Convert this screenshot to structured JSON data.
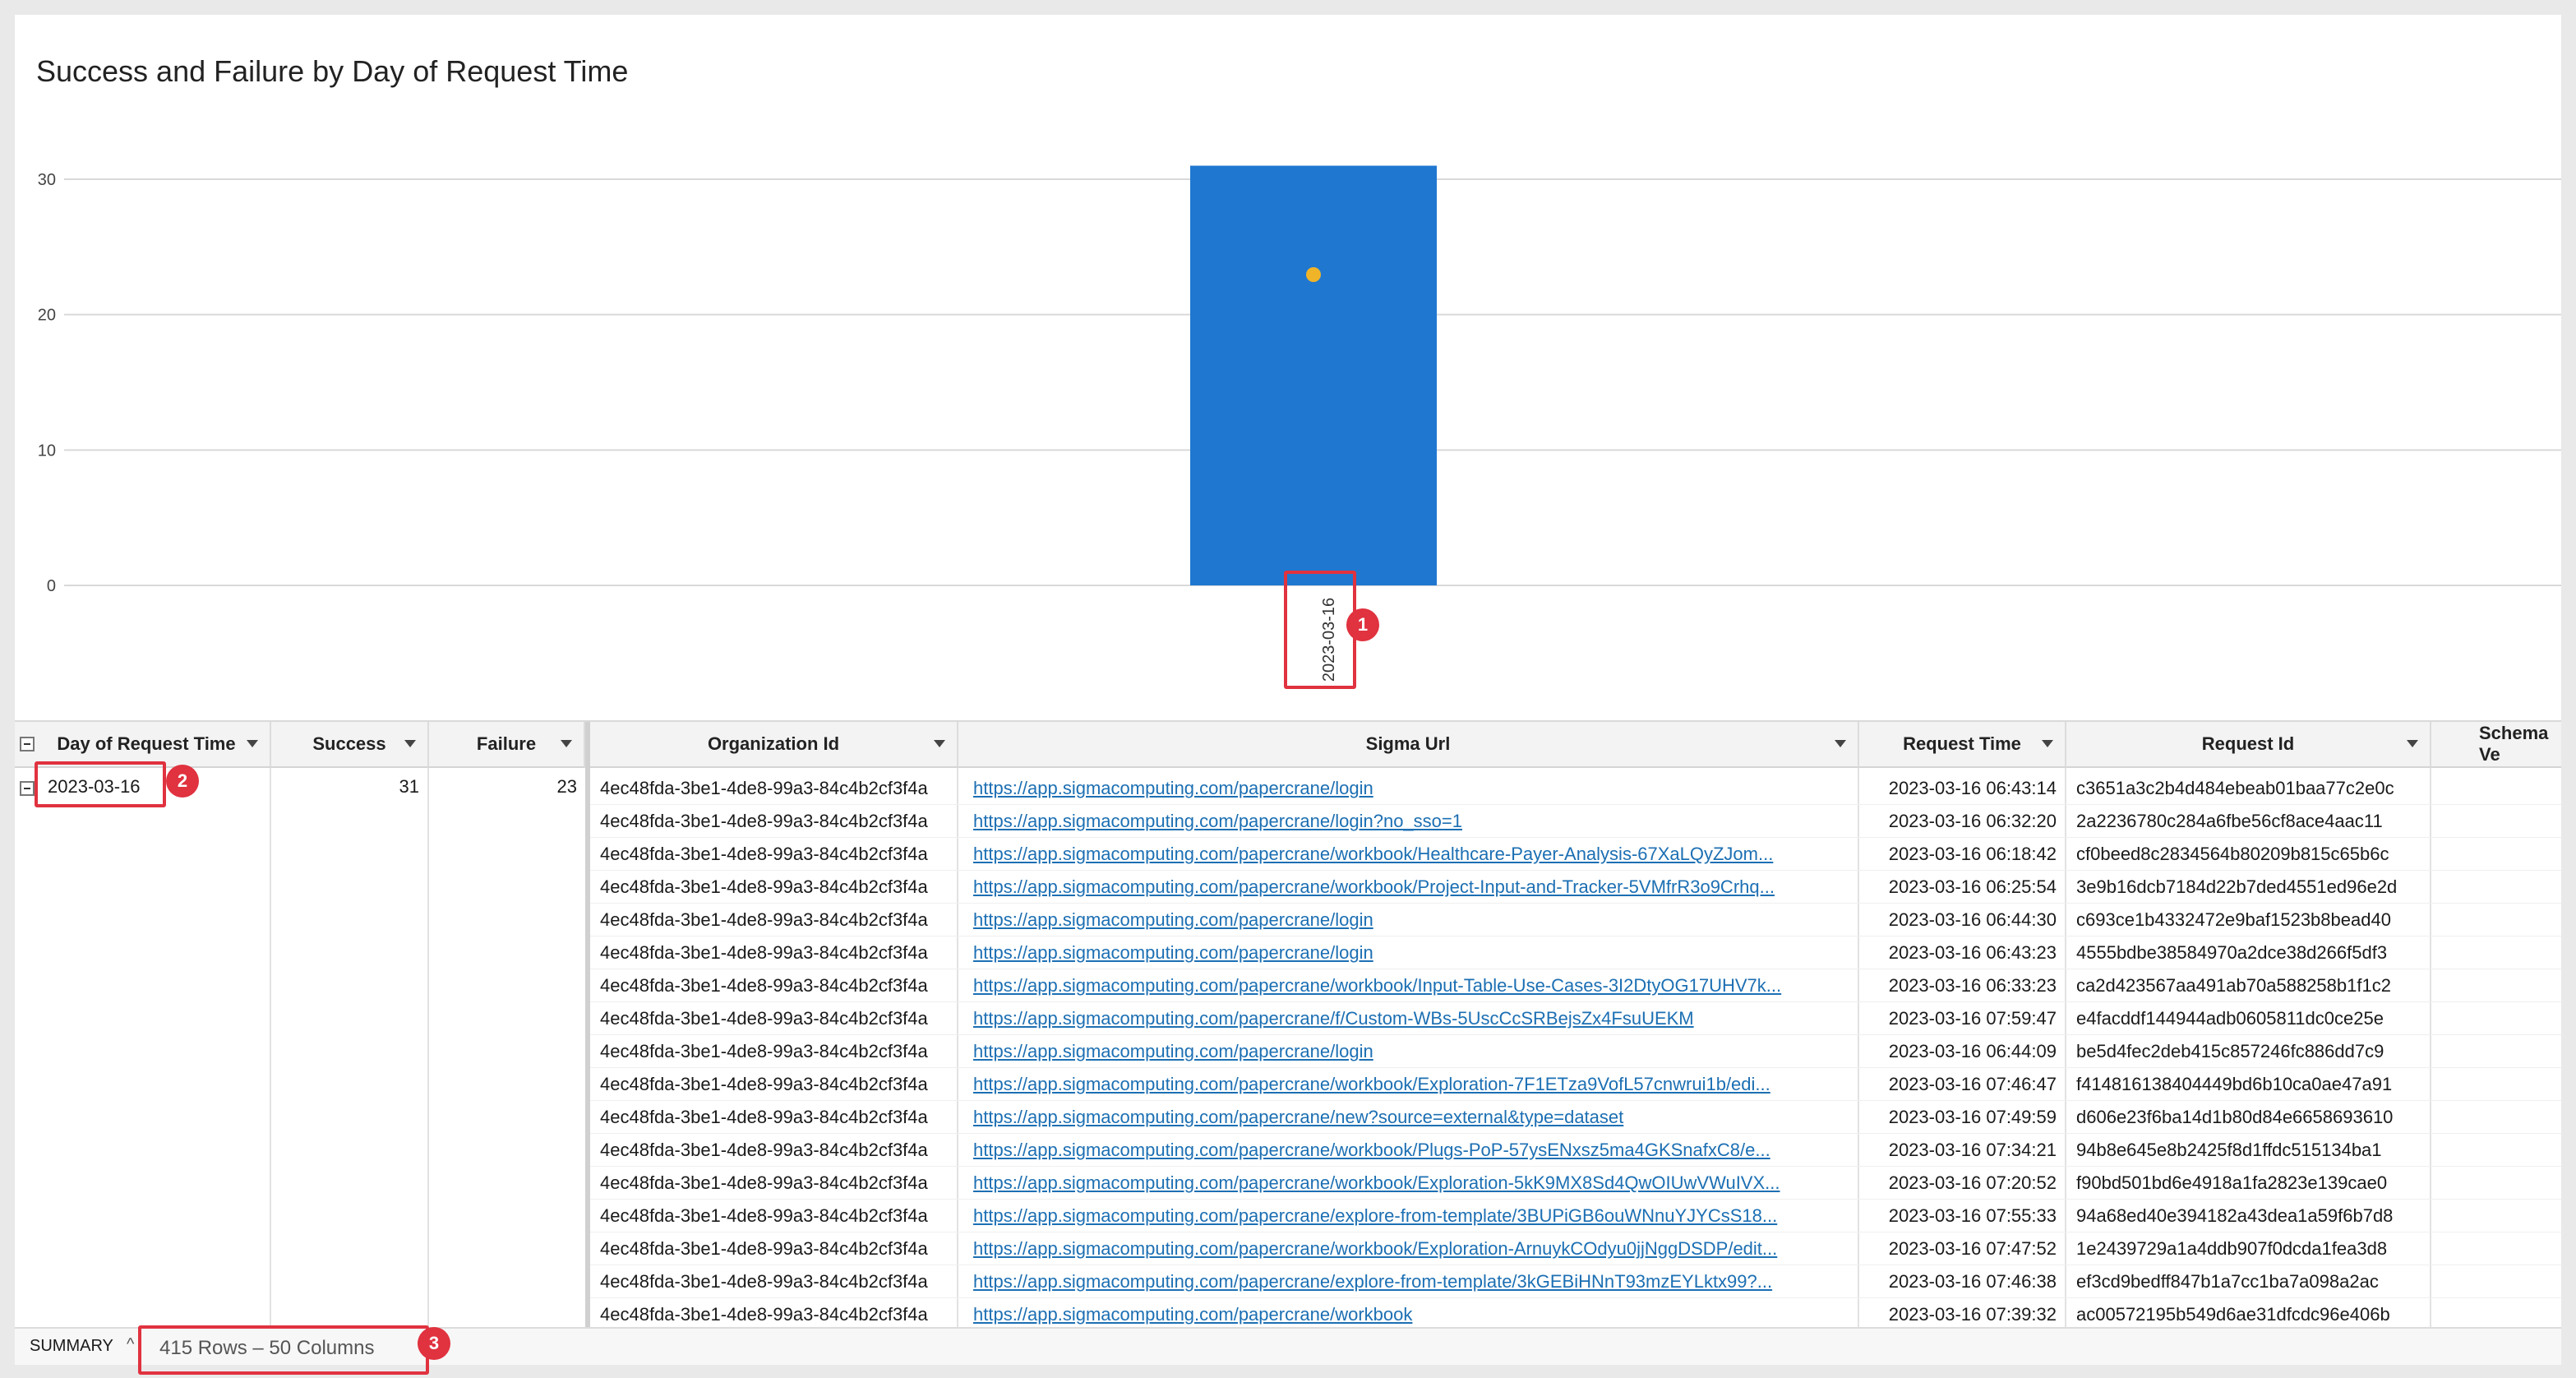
{
  "chart": {
    "title": "Success and Failure by Day of Request Time"
  },
  "chart_data": {
    "type": "bar",
    "title": "Success and Failure by Day of Request Time",
    "categories": [
      "2023-03-16"
    ],
    "series": [
      {
        "name": "Success",
        "values": [
          31
        ],
        "color": "#1f77d0",
        "mark": "bar"
      },
      {
        "name": "Failure",
        "values": [
          23
        ],
        "color": "#f0b429",
        "mark": "point"
      }
    ],
    "yticks": [
      "0",
      "10",
      "20",
      "30"
    ],
    "ylim": [
      0,
      32
    ],
    "grid": true
  },
  "callouts": [
    "1",
    "2",
    "3"
  ],
  "left_table": {
    "headers": [
      "Day of Request Time",
      "Success",
      "Failure"
    ],
    "rows": [
      {
        "day": "2023-03-16",
        "success": "31",
        "failure": "23"
      }
    ]
  },
  "main_table": {
    "headers": [
      "Organization Id",
      "Sigma Url",
      "Request Time",
      "Request Id",
      "Schema Ve"
    ],
    "rows": [
      [
        "4ec48fda-3be1-4de8-99a3-84c4b2cf3f4a",
        "https://app.sigmacomputing.com/papercrane/login",
        "2023-03-16 06:43:14",
        "c3651a3c2b4d484ebeab01baa77c2e0c"
      ],
      [
        "4ec48fda-3be1-4de8-99a3-84c4b2cf3f4a",
        "https://app.sigmacomputing.com/papercrane/login?no_sso=1",
        "2023-03-16 06:32:20",
        "2a2236780c284a6fbe56cf8ace4aac11"
      ],
      [
        "4ec48fda-3be1-4de8-99a3-84c4b2cf3f4a",
        "https://app.sigmacomputing.com/papercrane/workbook/Healthcare-Payer-Analysis-67XaLQyZJom...",
        "2023-03-16 06:18:42",
        "cf0beed8c2834564b80209b815c65b6c"
      ],
      [
        "4ec48fda-3be1-4de8-99a3-84c4b2cf3f4a",
        "https://app.sigmacomputing.com/papercrane/workbook/Project-Input-and-Tracker-5VMfrR3o9Crhq...",
        "2023-03-16 06:25:54",
        "3e9b16dcb7184d22b7ded4551ed96e2d"
      ],
      [
        "4ec48fda-3be1-4de8-99a3-84c4b2cf3f4a",
        "https://app.sigmacomputing.com/papercrane/login",
        "2023-03-16 06:44:30",
        "c693ce1b4332472e9baf1523b8bead40"
      ],
      [
        "4ec48fda-3be1-4de8-99a3-84c4b2cf3f4a",
        "https://app.sigmacomputing.com/papercrane/login",
        "2023-03-16 06:43:23",
        "4555bdbe38584970a2dce38d266f5df3"
      ],
      [
        "4ec48fda-3be1-4de8-99a3-84c4b2cf3f4a",
        "https://app.sigmacomputing.com/papercrane/workbook/Input-Table-Use-Cases-3I2DtyOG17UHV7k...",
        "2023-03-16 06:33:23",
        "ca2d423567aa491ab70a588258b1f1c2"
      ],
      [
        "4ec48fda-3be1-4de8-99a3-84c4b2cf3f4a",
        "https://app.sigmacomputing.com/papercrane/f/Custom-WBs-5UscCcSRBejsZx4FsuUEKM",
        "2023-03-16 07:59:47",
        "e4facddf144944adb0605811dc0ce25e"
      ],
      [
        "4ec48fda-3be1-4de8-99a3-84c4b2cf3f4a",
        "https://app.sigmacomputing.com/papercrane/login",
        "2023-03-16 06:44:09",
        "be5d4fec2deb415c857246fc886dd7c9"
      ],
      [
        "4ec48fda-3be1-4de8-99a3-84c4b2cf3f4a",
        "https://app.sigmacomputing.com/papercrane/workbook/Exploration-7F1ETza9VofL57cnwrui1b/edi...",
        "2023-03-16 07:46:47",
        "f414816138404449bd6b10ca0ae47a91"
      ],
      [
        "4ec48fda-3be1-4de8-99a3-84c4b2cf3f4a",
        "https://app.sigmacomputing.com/papercrane/new?source=external&type=dataset",
        "2023-03-16 07:49:59",
        "d606e23f6ba14d1b80d84e6658693610"
      ],
      [
        "4ec48fda-3be1-4de8-99a3-84c4b2cf3f4a",
        "https://app.sigmacomputing.com/papercrane/workbook/Plugs-PoP-57ysENxsz5ma4GKSnafxC8/e...",
        "2023-03-16 07:34:21",
        "94b8e645e8b2425f8d1ffdc515134ba1"
      ],
      [
        "4ec48fda-3be1-4de8-99a3-84c4b2cf3f4a",
        "https://app.sigmacomputing.com/papercrane/workbook/Exploration-5kK9MX8Sd4QwOIUwVWuIVX...",
        "2023-03-16 07:20:52",
        "f90bd501bd6e4918a1fa2823e139cae0"
      ],
      [
        "4ec48fda-3be1-4de8-99a3-84c4b2cf3f4a",
        "https://app.sigmacomputing.com/papercrane/explore-from-template/3BUPiGB6ouWNnuYJYCsS18...",
        "2023-03-16 07:55:33",
        "94a68ed40e394182a43dea1a59f6b7d8"
      ],
      [
        "4ec48fda-3be1-4de8-99a3-84c4b2cf3f4a",
        "https://app.sigmacomputing.com/papercrane/workbook/Exploration-ArnuykCOdyu0jjNggDSDP/edit...",
        "2023-03-16 07:47:52",
        "1e2439729a1a4ddb907f0dcda1fea3d8"
      ],
      [
        "4ec48fda-3be1-4de8-99a3-84c4b2cf3f4a",
        "https://app.sigmacomputing.com/papercrane/explore-from-template/3kGEBiHNnT93mzEYLktx99?...",
        "2023-03-16 07:46:38",
        "ef3cd9bedff847b1a7cc1ba7a098a2ac"
      ],
      [
        "4ec48fda-3be1-4de8-99a3-84c4b2cf3f4a",
        "https://app.sigmacomputing.com/papercrane/workbook",
        "2023-03-16 07:39:32",
        "ac00572195b549d6ae31dfcdc96e406b"
      ]
    ]
  },
  "footer": {
    "summary_label": "SUMMARY",
    "rows_columns": "415 Rows – 50 Columns"
  }
}
